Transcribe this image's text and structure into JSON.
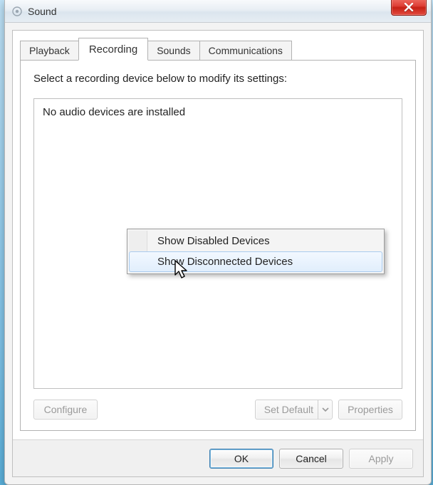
{
  "window": {
    "title": "Sound"
  },
  "tabs": {
    "playback": "Playback",
    "recording": "Recording",
    "sounds": "Sounds",
    "communications": "Communications"
  },
  "page": {
    "instruction": "Select a recording device below to modify its settings:",
    "empty_message": "No audio devices are installed"
  },
  "buttons": {
    "configure": "Configure",
    "set_default": "Set Default",
    "properties": "Properties",
    "ok": "OK",
    "cancel": "Cancel",
    "apply": "Apply"
  },
  "context_menu": {
    "show_disabled": "Show Disabled Devices",
    "show_disconnected": "Show Disconnected Devices"
  }
}
